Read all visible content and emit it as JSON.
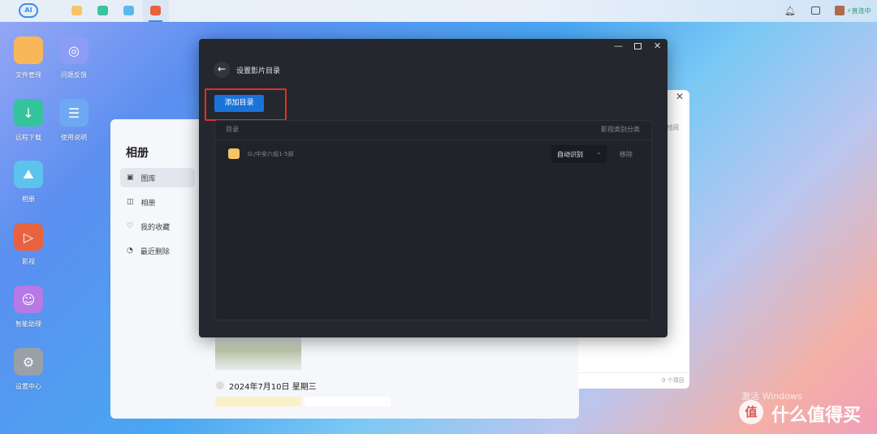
{
  "topbar": {
    "logo": "AI",
    "status": "直连中",
    "active_tab": "video"
  },
  "desktop": [
    {
      "label": "文件管理",
      "color": "#f8b85a"
    },
    {
      "label": "问题反馈",
      "color": "#8d9cf4"
    },
    {
      "label": "远程下载",
      "color": "#35c39b"
    },
    {
      "label": "使用说明",
      "color": "#6fa8f2"
    },
    {
      "label": "相册",
      "color": "#5cc3ef"
    },
    {
      "label": "影视",
      "color": "#e8623f"
    },
    {
      "label": "智能助理",
      "color": "#b57ae6"
    },
    {
      "label": "设置中心",
      "color": "#9aa0a8"
    }
  ],
  "photos": {
    "title": "相册",
    "nav": [
      "图库",
      "相册",
      "我的收藏",
      "最近删除"
    ],
    "date": "2024年7月10日 星期三"
  },
  "backwin": {
    "col": "时间",
    "count": "0 个项目"
  },
  "dialog": {
    "title": "设置影片目录",
    "add_button": "添加目录",
    "col_dir": "目录",
    "col_category": "影视类别分类",
    "rows": [
      {
        "path": "G:/中安六组1-5部",
        "category": "自动识别",
        "remove": "移除"
      }
    ]
  },
  "watermark": {
    "activate": "激活 Windows",
    "brand": "什么值得买",
    "badge": "值"
  },
  "colors": {
    "accent": "#1a73d9",
    "highlight": "#e0302a",
    "dialog_bg": "#24272e"
  }
}
